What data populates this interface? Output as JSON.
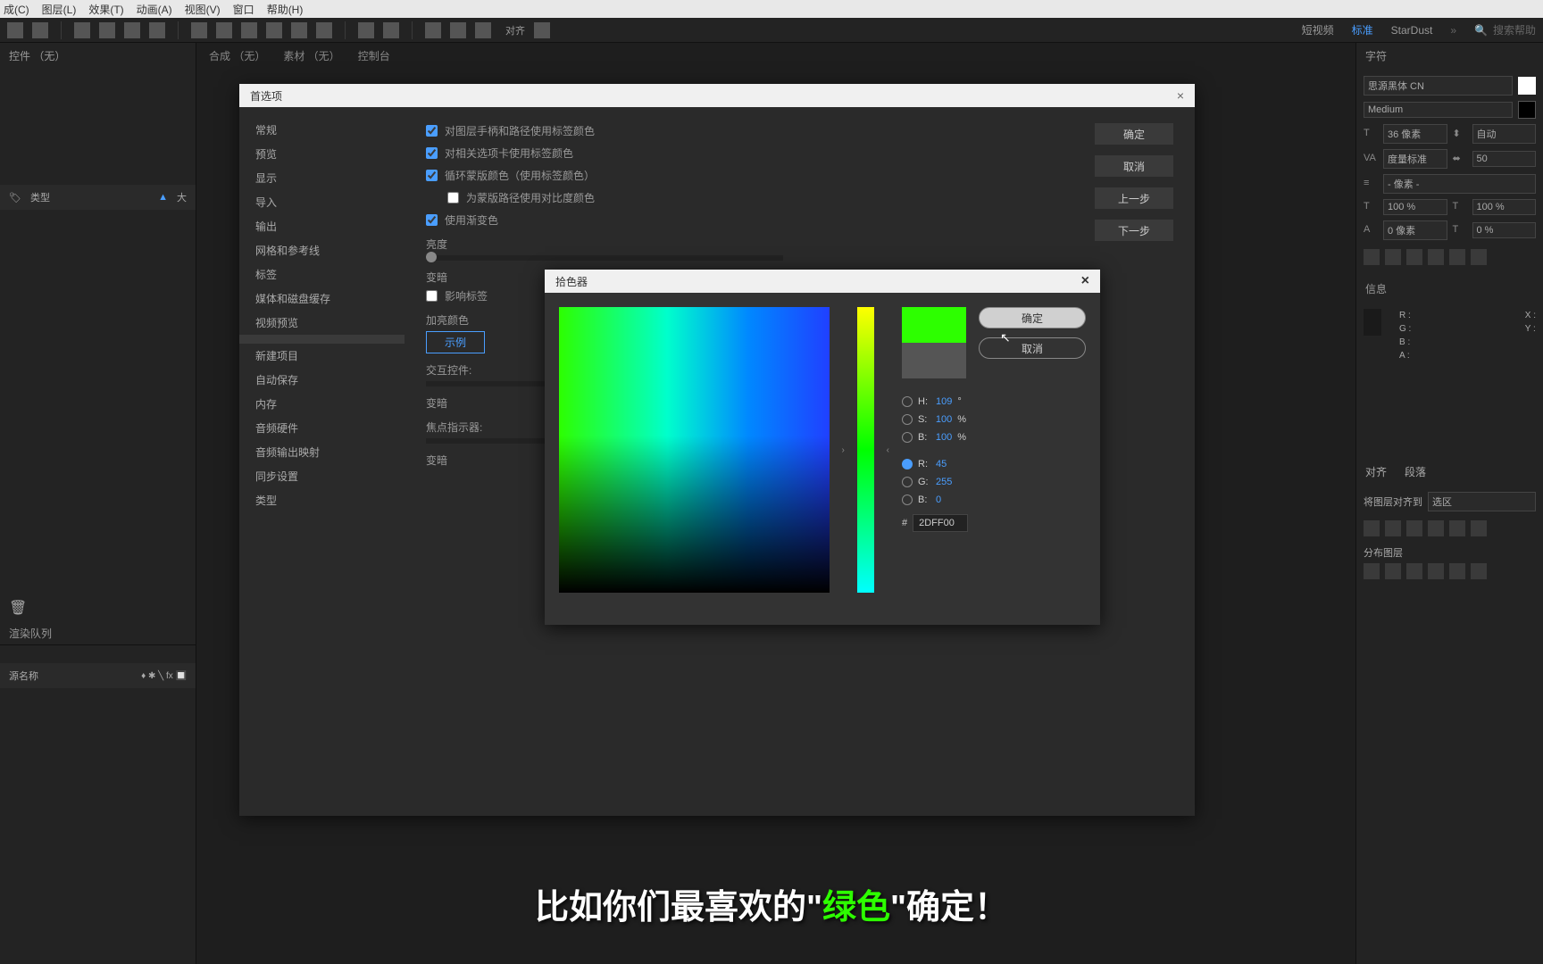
{
  "menubar": {
    "items": [
      "成(C)",
      "图层(L)",
      "效果(T)",
      "动画(A)",
      "视图(V)",
      "窗口",
      "帮助(H)"
    ]
  },
  "toolbar": {
    "align_label": "对齐",
    "workspaces": [
      "短视频",
      "标准",
      "StarDust"
    ],
    "active_workspace": 1,
    "search_placeholder": "搜索帮助"
  },
  "left": {
    "controls_title": "控件 （无）",
    "type_label": "类型",
    "size_label": "大",
    "render_queue": "渲染队列",
    "source_name": "源名称"
  },
  "center": {
    "comp_tab": "合成 （无）",
    "sources_tab": "素材 （无）",
    "console_tab": "控制台"
  },
  "prefs": {
    "title": "首选项",
    "sidebar": [
      "常规",
      "预览",
      "显示",
      "导入",
      "输出",
      "网格和参考线",
      "标签",
      "媒体和磁盘缓存",
      "视频预览",
      "",
      "新建项目",
      "自动保存",
      "内存",
      "音频硬件",
      "音频输出映射",
      "同步设置",
      "类型"
    ],
    "selected_index": 9,
    "checks": [
      "对图层手柄和路径使用标签颜色",
      "对相关选项卡使用标签颜色",
      "循环蒙版颜色（使用标签颜色）",
      "为蒙版路径使用对比度颜色",
      "使用渐变色"
    ],
    "check_states": [
      true,
      true,
      true,
      false,
      true
    ],
    "sliders": {
      "brightness": "亮度",
      "darken": "变暗",
      "affect_labels": "影响标签",
      "highlight": "加亮颜色",
      "sample": "示例",
      "interact": "交互控件:",
      "darken2": "变暗",
      "focus": "焦点指示器:",
      "darken3": "变暗"
    },
    "buttons": {
      "ok": "确定",
      "cancel": "取消",
      "prev": "上一步",
      "next": "下一步"
    }
  },
  "colorpicker": {
    "title": "拾色器",
    "ok": "确定",
    "cancel": "取消",
    "h": "109",
    "s": "100",
    "b": "100",
    "r": "45",
    "g": "255",
    "b2": "0",
    "hex": "2DFF00"
  },
  "right": {
    "char_title": "字符",
    "font": "思源黑体 CN",
    "weight": "Medium",
    "size": "36 像素",
    "leading": "自动",
    "kerning": "度量标准",
    "tracking": "50",
    "hscale": "100 %",
    "vscale": "100 %",
    "baseline": "0 像素",
    "tsume": "0 %",
    "pixel_unit": "- 像素 -",
    "info_title": "信息",
    "info": {
      "r": "R :",
      "g": "G :",
      "b": "B :",
      "a": "A :",
      "x": "X :",
      "y": "Y :"
    },
    "align_title": "对齐",
    "para_title": "段落",
    "align_to": "将图层对齐到",
    "align_target": "选区",
    "distribute": "分布图层"
  },
  "caption": {
    "pre": "比如你们最喜欢的\"",
    "highlight": "绿色",
    "post": "\"确定！"
  }
}
